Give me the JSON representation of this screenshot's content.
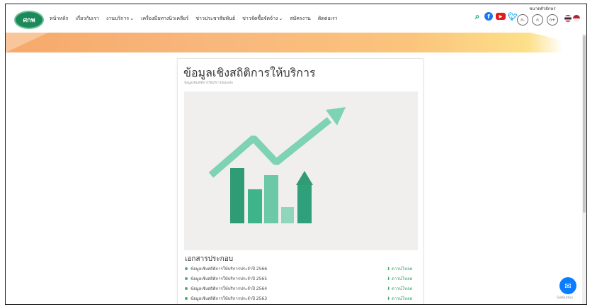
{
  "header": {
    "logo_text": "ศกพ",
    "logo_sub": "ACDP",
    "nav": [
      {
        "label": "หน้าหลัก",
        "dropdown": false
      },
      {
        "label": "เกี่ยวกับเรา",
        "dropdown": false
      },
      {
        "label": "งานบริการ",
        "dropdown": true
      },
      {
        "label": "เครื่องมือทางนิวเคลียร์",
        "dropdown": false
      },
      {
        "label": "ข่าวประชาสัมพันธ์",
        "dropdown": false
      },
      {
        "label": "ข่าวจัดซื้อจัดจ้าง",
        "dropdown": true
      },
      {
        "label": "สมัครงาน",
        "dropdown": false
      },
      {
        "label": "ติดต่อเรา",
        "dropdown": false
      }
    ],
    "font_size_label": "ขนาดตัวอักษร",
    "font_buttons": [
      "ก-",
      "ก",
      "ก+"
    ],
    "icons": [
      "search-icon",
      "facebook-icon",
      "youtube-icon",
      "twitter-icon"
    ],
    "colors": {
      "accent": "#1a8a5a",
      "facebook": "#1877f2",
      "youtube": "#e31b1b"
    }
  },
  "page": {
    "title": "ข้อมูลเชิงสถิติการให้บริการ",
    "subtitle": "ข้อมูลเชิงสถิติการให้บริการย้อนหลัง",
    "documents_heading": "เอกสารประกอบ",
    "documents": [
      {
        "name": "ข้อมูลเชิงสถิติการให้บริการประจำปี 2566",
        "link": "ดาวน์โหลด"
      },
      {
        "name": "ข้อมูลเชิงสถิติการให้บริการประจำปี 2565",
        "link": "ดาวน์โหลด"
      },
      {
        "name": "ข้อมูลเชิงสถิติการให้บริการประจำปี 2564",
        "link": "ดาวน์โหลด"
      },
      {
        "name": "ข้อมูลเชิงสถิติการให้บริการประจำปี 2563",
        "link": "ดาวน์โหลด"
      }
    ]
  },
  "widgets": {
    "messenger_label": "GetButton"
  }
}
